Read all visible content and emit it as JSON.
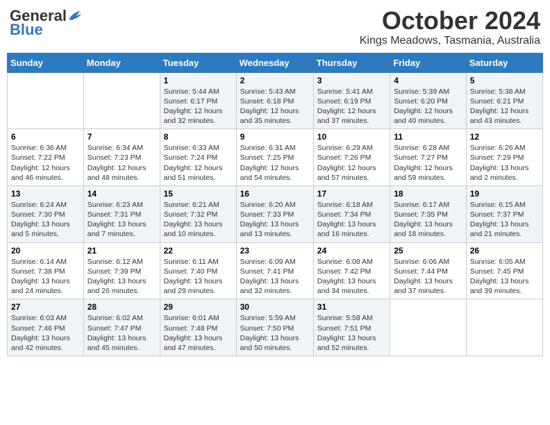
{
  "header": {
    "logo_general": "General",
    "logo_blue": "Blue",
    "month": "October 2024",
    "location": "Kings Meadows, Tasmania, Australia"
  },
  "days_of_week": [
    "Sunday",
    "Monday",
    "Tuesday",
    "Wednesday",
    "Thursday",
    "Friday",
    "Saturday"
  ],
  "weeks": [
    [
      {
        "day": "",
        "sunrise": "",
        "sunset": "",
        "daylight": ""
      },
      {
        "day": "",
        "sunrise": "",
        "sunset": "",
        "daylight": ""
      },
      {
        "day": "1",
        "sunrise": "Sunrise: 5:44 AM",
        "sunset": "Sunset: 6:17 PM",
        "daylight": "Daylight: 12 hours and 32 minutes."
      },
      {
        "day": "2",
        "sunrise": "Sunrise: 5:43 AM",
        "sunset": "Sunset: 6:18 PM",
        "daylight": "Daylight: 12 hours and 35 minutes."
      },
      {
        "day": "3",
        "sunrise": "Sunrise: 5:41 AM",
        "sunset": "Sunset: 6:19 PM",
        "daylight": "Daylight: 12 hours and 37 minutes."
      },
      {
        "day": "4",
        "sunrise": "Sunrise: 5:39 AM",
        "sunset": "Sunset: 6:20 PM",
        "daylight": "Daylight: 12 hours and 40 minutes."
      },
      {
        "day": "5",
        "sunrise": "Sunrise: 5:38 AM",
        "sunset": "Sunset: 6:21 PM",
        "daylight": "Daylight: 12 hours and 43 minutes."
      }
    ],
    [
      {
        "day": "6",
        "sunrise": "Sunrise: 6:36 AM",
        "sunset": "Sunset: 7:22 PM",
        "daylight": "Daylight: 12 hours and 46 minutes."
      },
      {
        "day": "7",
        "sunrise": "Sunrise: 6:34 AM",
        "sunset": "Sunset: 7:23 PM",
        "daylight": "Daylight: 12 hours and 48 minutes."
      },
      {
        "day": "8",
        "sunrise": "Sunrise: 6:33 AM",
        "sunset": "Sunset: 7:24 PM",
        "daylight": "Daylight: 12 hours and 51 minutes."
      },
      {
        "day": "9",
        "sunrise": "Sunrise: 6:31 AM",
        "sunset": "Sunset: 7:25 PM",
        "daylight": "Daylight: 12 hours and 54 minutes."
      },
      {
        "day": "10",
        "sunrise": "Sunrise: 6:29 AM",
        "sunset": "Sunset: 7:26 PM",
        "daylight": "Daylight: 12 hours and 57 minutes."
      },
      {
        "day": "11",
        "sunrise": "Sunrise: 6:28 AM",
        "sunset": "Sunset: 7:27 PM",
        "daylight": "Daylight: 12 hours and 59 minutes."
      },
      {
        "day": "12",
        "sunrise": "Sunrise: 6:26 AM",
        "sunset": "Sunset: 7:29 PM",
        "daylight": "Daylight: 13 hours and 2 minutes."
      }
    ],
    [
      {
        "day": "13",
        "sunrise": "Sunrise: 6:24 AM",
        "sunset": "Sunset: 7:30 PM",
        "daylight": "Daylight: 13 hours and 5 minutes."
      },
      {
        "day": "14",
        "sunrise": "Sunrise: 6:23 AM",
        "sunset": "Sunset: 7:31 PM",
        "daylight": "Daylight: 13 hours and 7 minutes."
      },
      {
        "day": "15",
        "sunrise": "Sunrise: 6:21 AM",
        "sunset": "Sunset: 7:32 PM",
        "daylight": "Daylight: 13 hours and 10 minutes."
      },
      {
        "day": "16",
        "sunrise": "Sunrise: 6:20 AM",
        "sunset": "Sunset: 7:33 PM",
        "daylight": "Daylight: 13 hours and 13 minutes."
      },
      {
        "day": "17",
        "sunrise": "Sunrise: 6:18 AM",
        "sunset": "Sunset: 7:34 PM",
        "daylight": "Daylight: 13 hours and 16 minutes."
      },
      {
        "day": "18",
        "sunrise": "Sunrise: 6:17 AM",
        "sunset": "Sunset: 7:35 PM",
        "daylight": "Daylight: 13 hours and 18 minutes."
      },
      {
        "day": "19",
        "sunrise": "Sunrise: 6:15 AM",
        "sunset": "Sunset: 7:37 PM",
        "daylight": "Daylight: 13 hours and 21 minutes."
      }
    ],
    [
      {
        "day": "20",
        "sunrise": "Sunrise: 6:14 AM",
        "sunset": "Sunset: 7:38 PM",
        "daylight": "Daylight: 13 hours and 24 minutes."
      },
      {
        "day": "21",
        "sunrise": "Sunrise: 6:12 AM",
        "sunset": "Sunset: 7:39 PM",
        "daylight": "Daylight: 13 hours and 26 minutes."
      },
      {
        "day": "22",
        "sunrise": "Sunrise: 6:11 AM",
        "sunset": "Sunset: 7:40 PM",
        "daylight": "Daylight: 13 hours and 29 minutes."
      },
      {
        "day": "23",
        "sunrise": "Sunrise: 6:09 AM",
        "sunset": "Sunset: 7:41 PM",
        "daylight": "Daylight: 13 hours and 32 minutes."
      },
      {
        "day": "24",
        "sunrise": "Sunrise: 6:08 AM",
        "sunset": "Sunset: 7:42 PM",
        "daylight": "Daylight: 13 hours and 34 minutes."
      },
      {
        "day": "25",
        "sunrise": "Sunrise: 6:06 AM",
        "sunset": "Sunset: 7:44 PM",
        "daylight": "Daylight: 13 hours and 37 minutes."
      },
      {
        "day": "26",
        "sunrise": "Sunrise: 6:05 AM",
        "sunset": "Sunset: 7:45 PM",
        "daylight": "Daylight: 13 hours and 39 minutes."
      }
    ],
    [
      {
        "day": "27",
        "sunrise": "Sunrise: 6:03 AM",
        "sunset": "Sunset: 7:46 PM",
        "daylight": "Daylight: 13 hours and 42 minutes."
      },
      {
        "day": "28",
        "sunrise": "Sunrise: 6:02 AM",
        "sunset": "Sunset: 7:47 PM",
        "daylight": "Daylight: 13 hours and 45 minutes."
      },
      {
        "day": "29",
        "sunrise": "Sunrise: 6:01 AM",
        "sunset": "Sunset: 7:48 PM",
        "daylight": "Daylight: 13 hours and 47 minutes."
      },
      {
        "day": "30",
        "sunrise": "Sunrise: 5:59 AM",
        "sunset": "Sunset: 7:50 PM",
        "daylight": "Daylight: 13 hours and 50 minutes."
      },
      {
        "day": "31",
        "sunrise": "Sunrise: 5:58 AM",
        "sunset": "Sunset: 7:51 PM",
        "daylight": "Daylight: 13 hours and 52 minutes."
      },
      {
        "day": "",
        "sunrise": "",
        "sunset": "",
        "daylight": ""
      },
      {
        "day": "",
        "sunrise": "",
        "sunset": "",
        "daylight": ""
      }
    ]
  ]
}
